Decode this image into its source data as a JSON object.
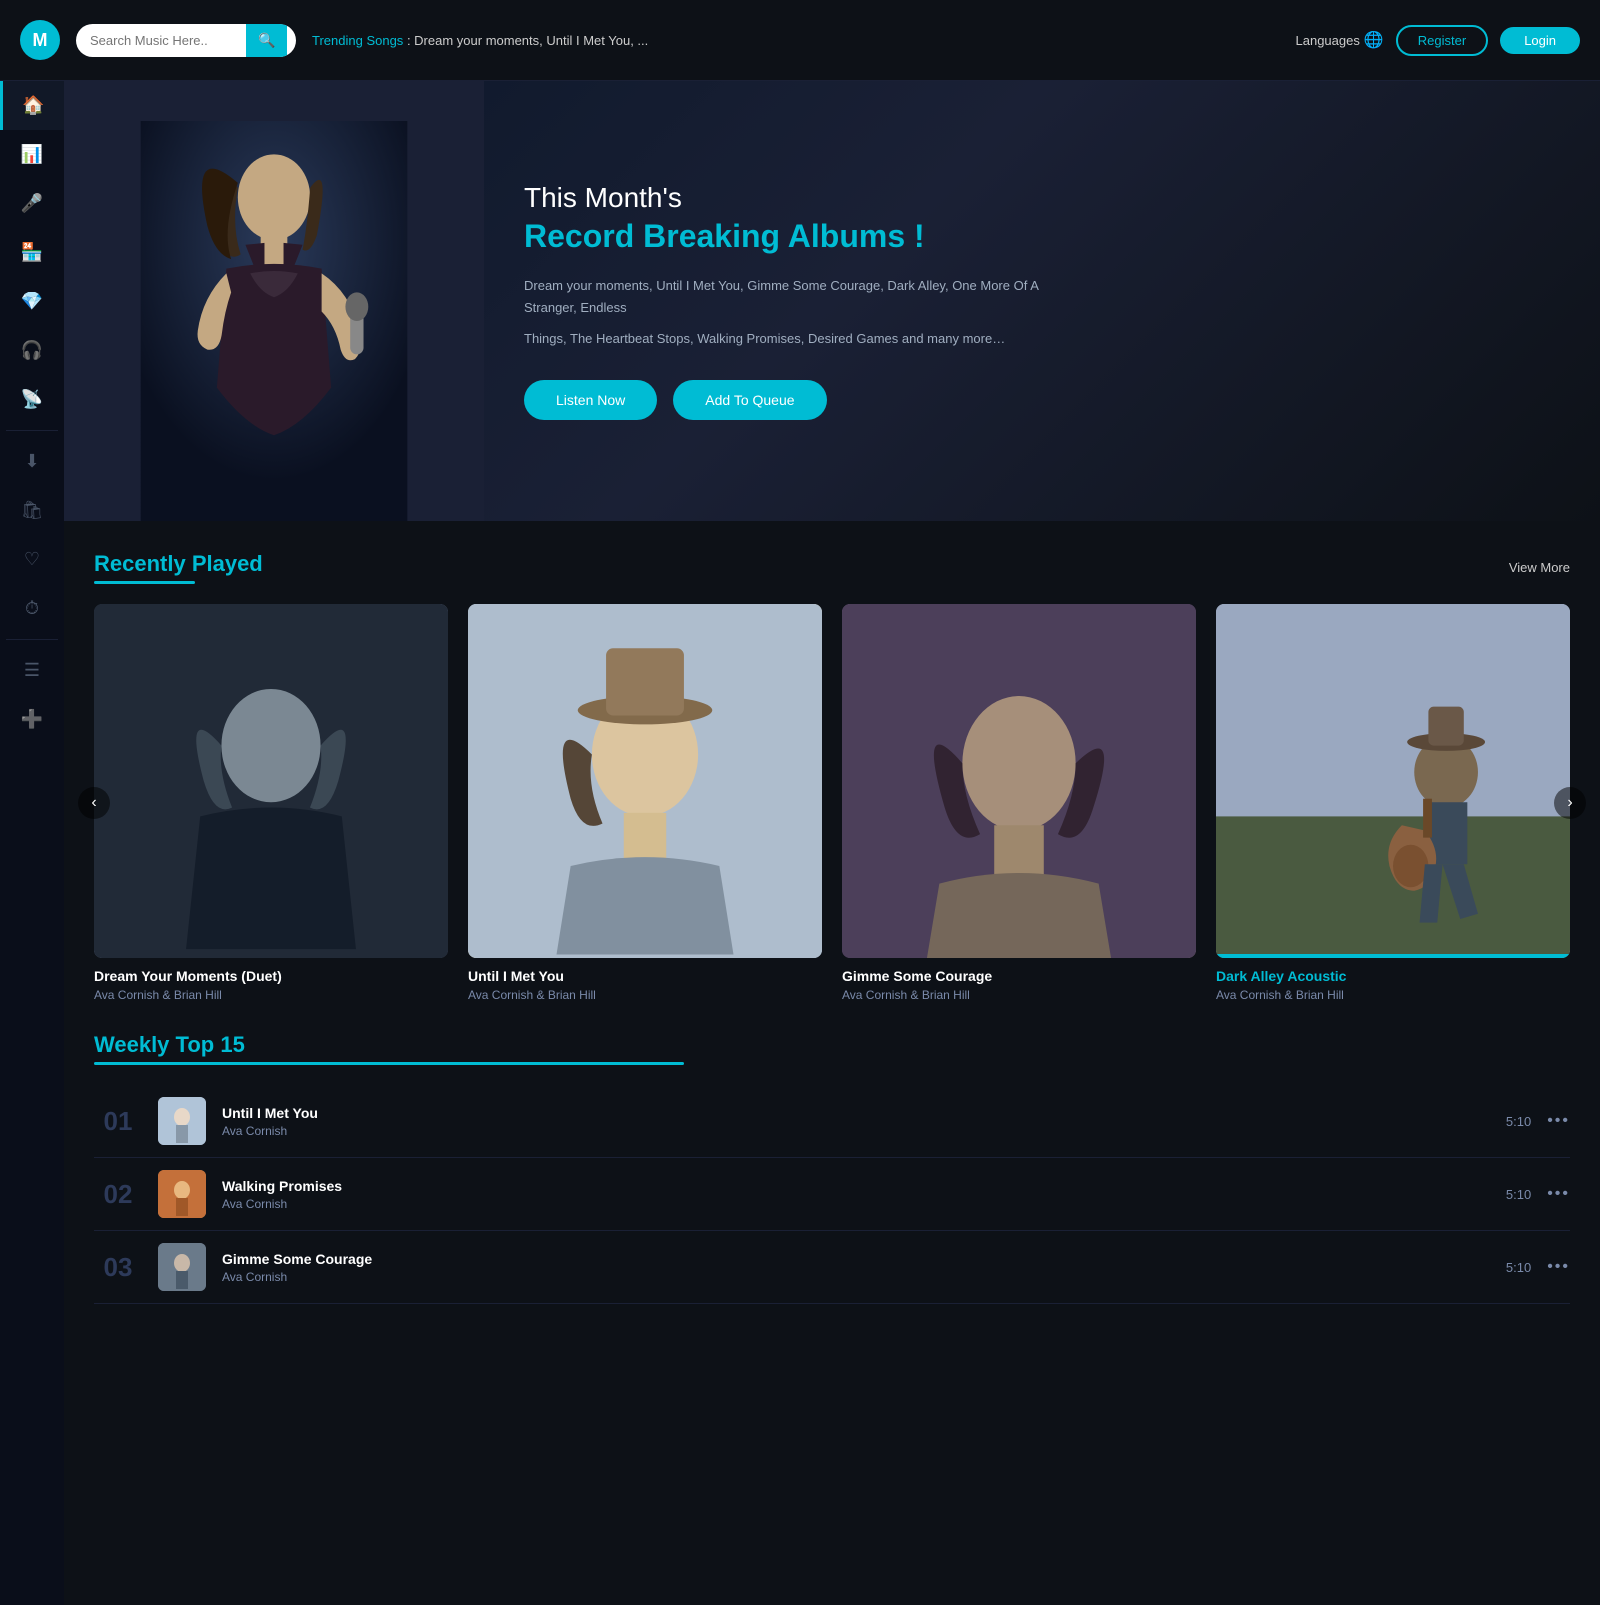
{
  "topnav": {
    "search_placeholder": "Search Music Here..",
    "trending_label": "Trending Songs",
    "trending_text": "Dream your moments, Until I Met You, ...",
    "languages_label": "Languages",
    "register_label": "Register",
    "login_label": "Login",
    "avatar_letter": "M"
  },
  "sidebar": {
    "items": [
      {
        "id": "home",
        "icon": "⌂",
        "label": "Home",
        "active": true
      },
      {
        "id": "chart",
        "icon": "▦",
        "label": "Chart",
        "active": false
      },
      {
        "id": "mic",
        "icon": "🎤",
        "label": "Microphone",
        "active": false
      },
      {
        "id": "store",
        "icon": "🏪",
        "label": "Store",
        "active": false
      },
      {
        "id": "gem",
        "icon": "💎",
        "label": "Premium",
        "active": false
      },
      {
        "id": "headphone",
        "icon": "🎧",
        "label": "Headphone",
        "active": false
      },
      {
        "id": "radio",
        "icon": "📡",
        "label": "Radio",
        "active": false
      },
      {
        "id": "download",
        "icon": "⬇",
        "label": "Download",
        "active": false
      },
      {
        "id": "bag",
        "icon": "🛍",
        "label": "Bag",
        "active": false
      },
      {
        "id": "heart",
        "icon": "♡",
        "label": "Favorites",
        "active": false
      },
      {
        "id": "history",
        "icon": "⏱",
        "label": "History",
        "active": false
      },
      {
        "id": "playlist",
        "icon": "☰",
        "label": "Playlist",
        "active": false
      },
      {
        "id": "addlist",
        "icon": "≡+",
        "label": "Add to list",
        "active": false
      }
    ]
  },
  "hero": {
    "subtitle": "This Month's",
    "title": "Record Breaking Albums !",
    "description1": "Dream your moments, Until I Met You, Gimme Some Courage, Dark Alley, One More Of A Stranger, Endless",
    "description2": "Things, The Heartbeat Stops, Walking Promises, Desired Games and many more…",
    "btn_listen": "Listen Now",
    "btn_queue": "Add To Queue"
  },
  "recently_played": {
    "section_title": "Recently Played",
    "view_more": "View More",
    "cards": [
      {
        "title": "Dream Your Moments (Duet)",
        "artist": "Ava Cornish & Brian Hill",
        "active": false,
        "img_class": "img-1"
      },
      {
        "title": "Until I Met You",
        "artist": "Ava Cornish & Brian Hill",
        "active": false,
        "img_class": "img-2"
      },
      {
        "title": "Gimme Some Courage",
        "artist": "Ava Cornish & Brian Hill",
        "active": false,
        "img_class": "img-3"
      },
      {
        "title": "Dark Alley Acoustic",
        "artist": "Ava Cornish & Brian Hill",
        "active": true,
        "img_class": "img-4"
      }
    ]
  },
  "weekly_top": {
    "section_title": "Weekly Top 15",
    "tracks": [
      {
        "number": "01",
        "title": "Until I Met You",
        "artist": "Ava Cornish",
        "duration": "5:10",
        "thumb_class": "t1"
      },
      {
        "number": "02",
        "title": "Walking Promises",
        "artist": "Ava Cornish",
        "duration": "5:10",
        "thumb_class": "t2"
      },
      {
        "number": "03",
        "title": "Gimme Some Courage",
        "artist": "Ava Cornish",
        "duration": "5:10",
        "thumb_class": "t3"
      }
    ]
  }
}
